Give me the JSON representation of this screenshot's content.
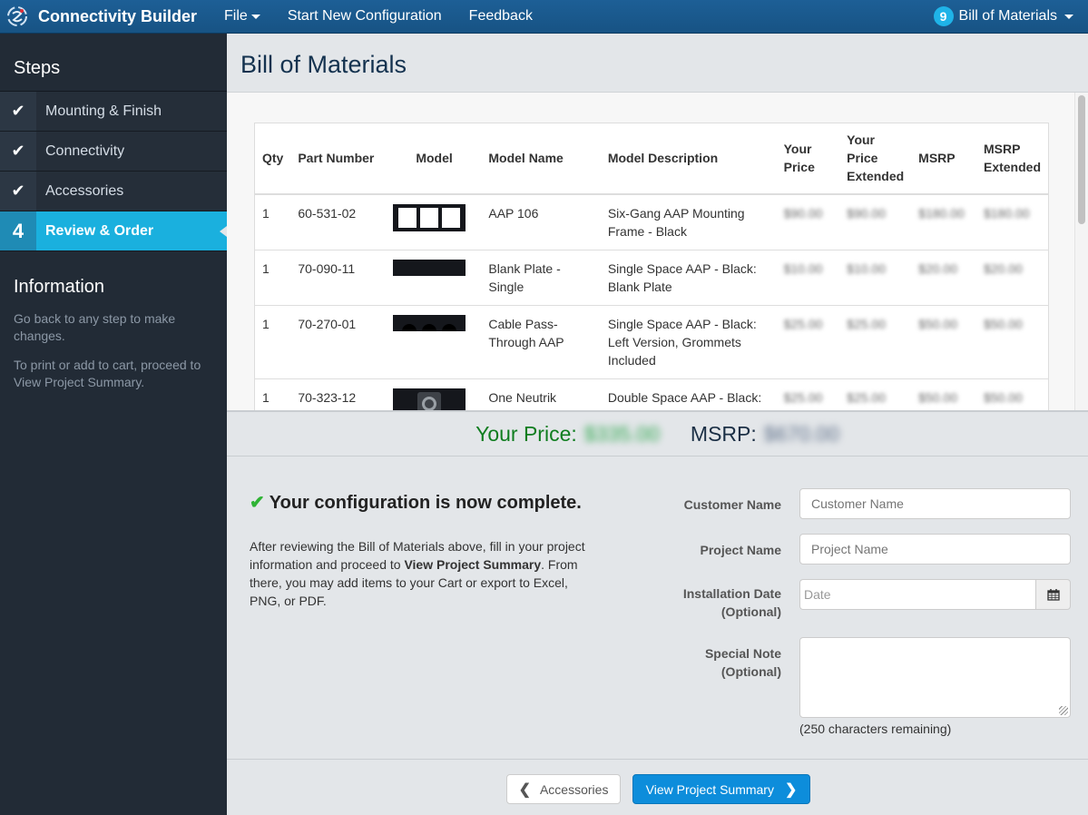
{
  "topbar": {
    "brand": "Connectivity Builder",
    "nav": [
      {
        "label": "File",
        "has_dropdown": true
      },
      {
        "label": "Start New Configuration"
      },
      {
        "label": "Feedback"
      }
    ],
    "bom_count": "9",
    "bom_label": "Bill of Materials"
  },
  "sidebar": {
    "steps_title": "Steps",
    "steps": [
      {
        "indicator": "check-icon",
        "label": "Mounting & Finish",
        "state": "complete"
      },
      {
        "indicator": "check-icon",
        "label": "Connectivity",
        "state": "complete"
      },
      {
        "indicator": "check-icon",
        "label": "Accessories",
        "state": "complete"
      },
      {
        "indicator": "4",
        "label": "Review & Order",
        "state": "active"
      }
    ],
    "info_title": "Information",
    "info_paragraphs": [
      "Go back to any step to make changes.",
      "To print or add to cart, proceed to View Project Summary."
    ]
  },
  "main": {
    "page_title": "Bill of Materials",
    "table": {
      "headers": [
        "Qty",
        "Part Number",
        "Model",
        "Model Name",
        "Model Description",
        "Your Price",
        "Your Price Extended",
        "MSRP",
        "MSRP Extended"
      ],
      "rows": [
        {
          "qty": "1",
          "part": "60-531-02",
          "model_icon": "six-gang-frame-image",
          "name": "AAP 106",
          "desc": "Six-Gang AAP Mounting Frame - Black",
          "price": "$90.00",
          "price_ext": "$90.00",
          "msrp": "$180.00",
          "msrp_ext": "$180.00"
        },
        {
          "qty": "1",
          "part": "70-090-11",
          "model_icon": "blank-plate-image",
          "name": "Blank Plate - Single",
          "desc": "Single Space AAP - Black: Blank Plate",
          "price": "$10.00",
          "price_ext": "$10.00",
          "msrp": "$20.00",
          "msrp_ext": "$20.00"
        },
        {
          "qty": "1",
          "part": "70-270-01",
          "model_icon": "cable-pass-through-image",
          "name": "Cable Pass-Through AAP",
          "desc": "Single Space AAP - Black: Left Version, Grommets Included",
          "price": "$25.00",
          "price_ext": "$25.00",
          "msrp": "$50.00",
          "msrp_ext": "$50.00"
        },
        {
          "qty": "1",
          "part": "70-323-12",
          "model_icon": "speakon-connector-image",
          "name": "One Neutrik Speakon Male to",
          "desc": "Double Space AAP - Black: One Neutrik Speakon Male",
          "price": "$25.00",
          "price_ext": "$25.00",
          "msrp": "$50.00",
          "msrp_ext": "$50.00"
        }
      ]
    },
    "totals": {
      "your_price_label": "Your Price:",
      "your_price_value": "$335.00",
      "msrp_label": "MSRP:",
      "msrp_value": "$670.00"
    },
    "completion": {
      "title": "Your configuration is now complete.",
      "text_before": "After reviewing the Bill of Materials above, fill in your project information and proceed to ",
      "text_bold": "View Project Summary",
      "text_after": ". From there, you may add items to your Cart or export to Excel, PNG, or PDF."
    },
    "form": {
      "customer_name_label": "Customer Name",
      "customer_name_placeholder": "Customer Name",
      "customer_name_value": "",
      "project_name_label": "Project Name",
      "project_name_placeholder": "Project Name",
      "project_name_value": "",
      "install_date_label": "Installation Date (Optional)",
      "install_date_placeholder": "Date",
      "install_date_value": "",
      "special_note_label": "Special Note (Optional)",
      "special_note_value": "",
      "remaining": "(250 characters remaining)"
    },
    "footer": {
      "back_label": "Accessories",
      "next_label": "View Project Summary"
    }
  },
  "colors": {
    "topbar": "#175384",
    "active_step": "#1ab0de",
    "your_price": "#0f7d1f",
    "primary_button": "#0d8ddb",
    "check_green": "#2fb335"
  }
}
